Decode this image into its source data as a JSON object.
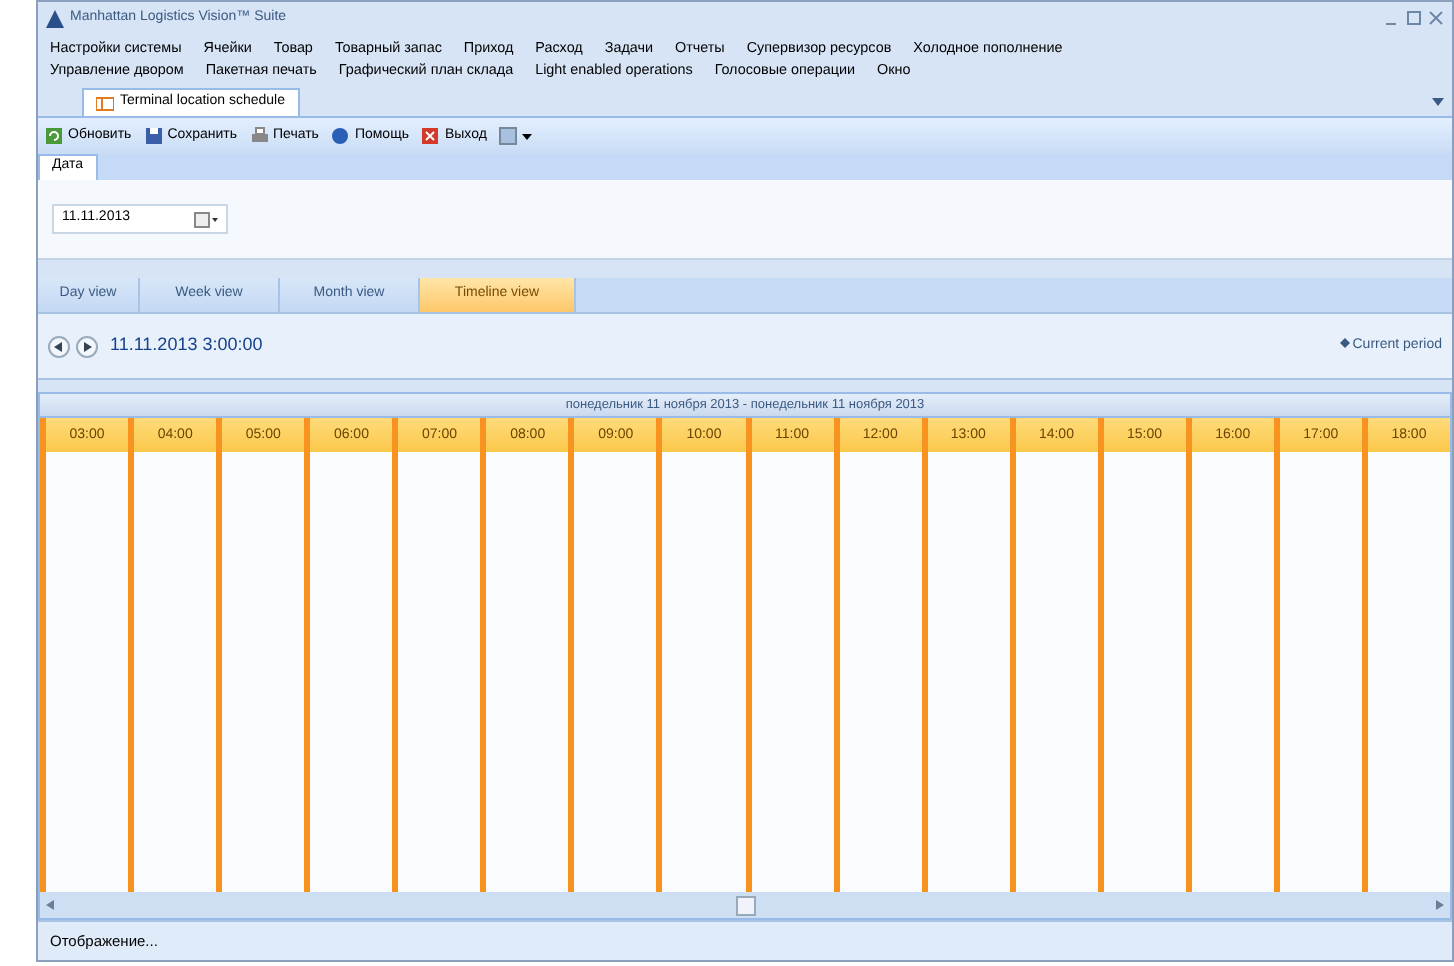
{
  "window": {
    "title": "Manhattan Logistics Vision™ Suite"
  },
  "menu_rows": [
    [
      "Настройки системы",
      "Ячейки",
      "Товар",
      "Товарный запас",
      "Приход",
      "Расход",
      "Задачи",
      "Отчеты",
      "Супервизор ресурсов",
      "Холодное пополнение"
    ],
    [
      "Управление двором",
      "Пакетная печать",
      "Графический план склада",
      "Light enabled operations",
      "Голосовые операции",
      "Окно"
    ]
  ],
  "document_tab": {
    "label": "Terminal location schedule"
  },
  "toolbar": [
    {
      "kind": "refresh",
      "label": "Обновить"
    },
    {
      "kind": "save",
      "label": "Сохранить"
    },
    {
      "kind": "print",
      "label": "Печать"
    },
    {
      "kind": "help",
      "label": "Помощь"
    },
    {
      "kind": "exit",
      "label": "Выход"
    },
    {
      "kind": "more"
    }
  ],
  "filter_tab": {
    "label": "Дата"
  },
  "date_field": {
    "value": "11.11.2013"
  },
  "view_tabs": [
    {
      "label": "Day view",
      "selected": false
    },
    {
      "label": "Week view",
      "selected": false
    },
    {
      "label": "Month view",
      "selected": false
    },
    {
      "label": "Timeline view",
      "selected": true
    }
  ],
  "navigation": {
    "current": "11.11.2013 3:00:00",
    "current_period": "Current period"
  },
  "timeline": {
    "range": "понедельник 11 ноября 2013 - понедельник 11 ноября 2013",
    "hours": [
      "03:00",
      "04:00",
      "05:00",
      "06:00",
      "07:00",
      "08:00",
      "09:00",
      "10:00",
      "11:00",
      "12:00",
      "13:00",
      "14:00",
      "15:00",
      "16:00",
      "17:00",
      "18:00"
    ]
  },
  "status_bar": "Отображение..."
}
